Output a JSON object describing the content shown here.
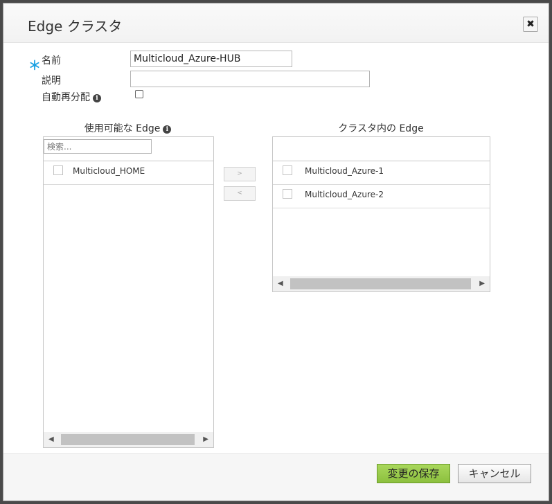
{
  "dialog": {
    "title": "Edge クラスタ",
    "close_icon": "✖"
  },
  "form": {
    "required_mark": "＊",
    "name_label": "名前",
    "name_value": "Multicloud_Azure-HUB",
    "description_label": "説明",
    "description_value": "",
    "auto_redistribute_label": "自動再分配",
    "auto_redistribute_checked": false
  },
  "available": {
    "title": "使用可能な Edge",
    "search_placeholder": "検索...",
    "items": [
      {
        "label": "Multicloud_HOME"
      }
    ]
  },
  "transfer": {
    "add_label": ">",
    "remove_label": "<"
  },
  "cluster": {
    "title": "クラスタ内の Edge",
    "items": [
      {
        "label": "Multicloud_Azure-1"
      },
      {
        "label": "Multicloud_Azure-2"
      }
    ]
  },
  "footer": {
    "save_label": "変更の保存",
    "cancel_label": "キャンセル"
  },
  "icons": {
    "info": "i",
    "scroll_left": "◀",
    "scroll_right": "▶"
  },
  "colors": {
    "required": "#1ba1e2",
    "save_button": "#8cc03e"
  }
}
